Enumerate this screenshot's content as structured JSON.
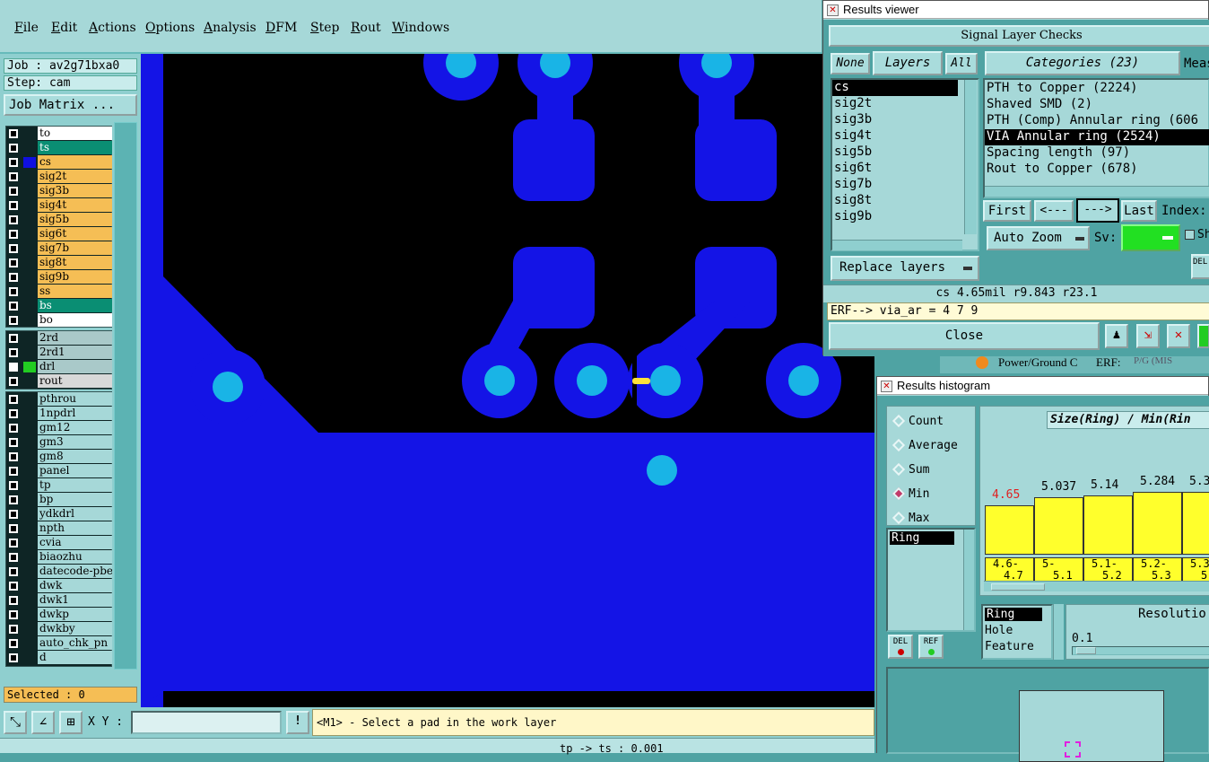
{
  "menu": [
    "File",
    "Edit",
    "Actions",
    "Options",
    "Analysis",
    "DFM",
    "Step",
    "Rout",
    "Windows"
  ],
  "job": {
    "job_label": "Job : av2g71bxa0",
    "step_label": "Step: cam",
    "matrix_button": "Job Matrix ..."
  },
  "layers_group1": [
    {
      "name": "to",
      "bg": "#ffffff"
    },
    {
      "name": "ts",
      "bg": "#0a8e73"
    },
    {
      "name": "cs",
      "bg": "#f5be55",
      "color": "#1010e0"
    },
    {
      "name": "sig2t",
      "bg": "#f5be55"
    },
    {
      "name": "sig3b",
      "bg": "#f5be55"
    },
    {
      "name": "sig4t",
      "bg": "#f5be55"
    },
    {
      "name": "sig5b",
      "bg": "#f5be55"
    },
    {
      "name": "sig6t",
      "bg": "#f5be55"
    },
    {
      "name": "sig7b",
      "bg": "#f5be55"
    },
    {
      "name": "sig8t",
      "bg": "#f5be55"
    },
    {
      "name": "sig9b",
      "bg": "#f5be55"
    },
    {
      "name": "ss",
      "bg": "#f5be55"
    },
    {
      "name": "bs",
      "bg": "#0a8e73"
    },
    {
      "name": "bo",
      "bg": "#ffffff"
    }
  ],
  "layers_group2": [
    {
      "name": "2rd",
      "bg": "#a9c9c9"
    },
    {
      "name": "2rd1",
      "bg": "#a9c9c9"
    },
    {
      "name": "drl",
      "bg": "#a9c9c9",
      "color": "#22cc22",
      "checked": true
    },
    {
      "name": "rout",
      "bg": "#d8d8d8"
    }
  ],
  "layers_group3": [
    "pthrou",
    "1npdrl",
    "gm12",
    "gm3",
    "gm8",
    "panel",
    "tp",
    "bp",
    "ydkdrl",
    "npth",
    "cvia",
    "biaozhu",
    "datecode-pbe",
    "dwk",
    "dwk1",
    "dwkp",
    "dwkby",
    "auto_chk_pn",
    "d"
  ],
  "selected_label": "Selected : 0",
  "xy_label": "X Y :",
  "xy_value": "",
  "prompt": "<M1> - Select a pad in the work layer",
  "status_text": "tp -> ts : 0.001",
  "results_viewer": {
    "title": "Results viewer",
    "header": "Signal Layer Checks",
    "tab_none": "None",
    "tab_layers": "Layers",
    "tab_all": "All",
    "categories_tab": "Categories (23)",
    "meas_tab": "Meas",
    "layers": [
      "cs",
      "sig2t",
      "sig3b",
      "sig4t",
      "sig5b",
      "sig6t",
      "sig7b",
      "sig8t",
      "sig9b"
    ],
    "categories": [
      "PTH to Copper (2224)",
      "Shaved SMD (2)",
      "PTH (Comp) Annular ring (606",
      "VIA Annular ring (2524)",
      "Spacing length (97)",
      "Rout to Copper (678)"
    ],
    "nav_first": "First",
    "nav_prev": "<---",
    "nav_next": "--->",
    "nav_last": "Last",
    "index_label": "Index:",
    "auto_zoom": "Auto Zoom",
    "sv_label": "Sv:",
    "sh_label": "Sh",
    "replace_layers": "Replace layers",
    "measure_line": "cs 4.65mil   r9.843   r23.1",
    "erf_line": "ERF--> via_ar = 4 7 9",
    "close": "Close",
    "del_label": "DEL",
    "ref_label": "REF"
  },
  "behind_text": {
    "label": "Power/Ground C",
    "erf": "ERF:",
    "rest": "P/G (MIS"
  },
  "histogram": {
    "title": "Results histogram",
    "options": [
      "Count",
      "Average",
      "Sum",
      "Min",
      "Max"
    ],
    "selected_option": "Min",
    "chart_title": "Size(Ring) / Min(Rin",
    "left_list": [
      "Ring"
    ],
    "bars": [
      {
        "value": "4.65",
        "range1": "4.6-",
        "range2": "4.7",
        "red": true
      },
      {
        "value": "5.037",
        "range1": "5-",
        "range2": "5.1"
      },
      {
        "value": "5.14",
        "range1": "5.1-",
        "range2": "5.2"
      },
      {
        "value": "5.284",
        "range1": "5.2-",
        "range2": "5.3"
      },
      {
        "value": "5.3",
        "range1": "5.3",
        "range2": "5."
      }
    ],
    "bottom_list": [
      "Ring",
      "Hole",
      "Feature"
    ],
    "resolution_label": "Resolutio",
    "resolution_value": "0.1",
    "del_label": "DEL",
    "ref_label": "REF"
  },
  "colors": {
    "copper": "#1414e6",
    "drill": "#19b4e6",
    "panel_teal": "#a6d8d8"
  }
}
